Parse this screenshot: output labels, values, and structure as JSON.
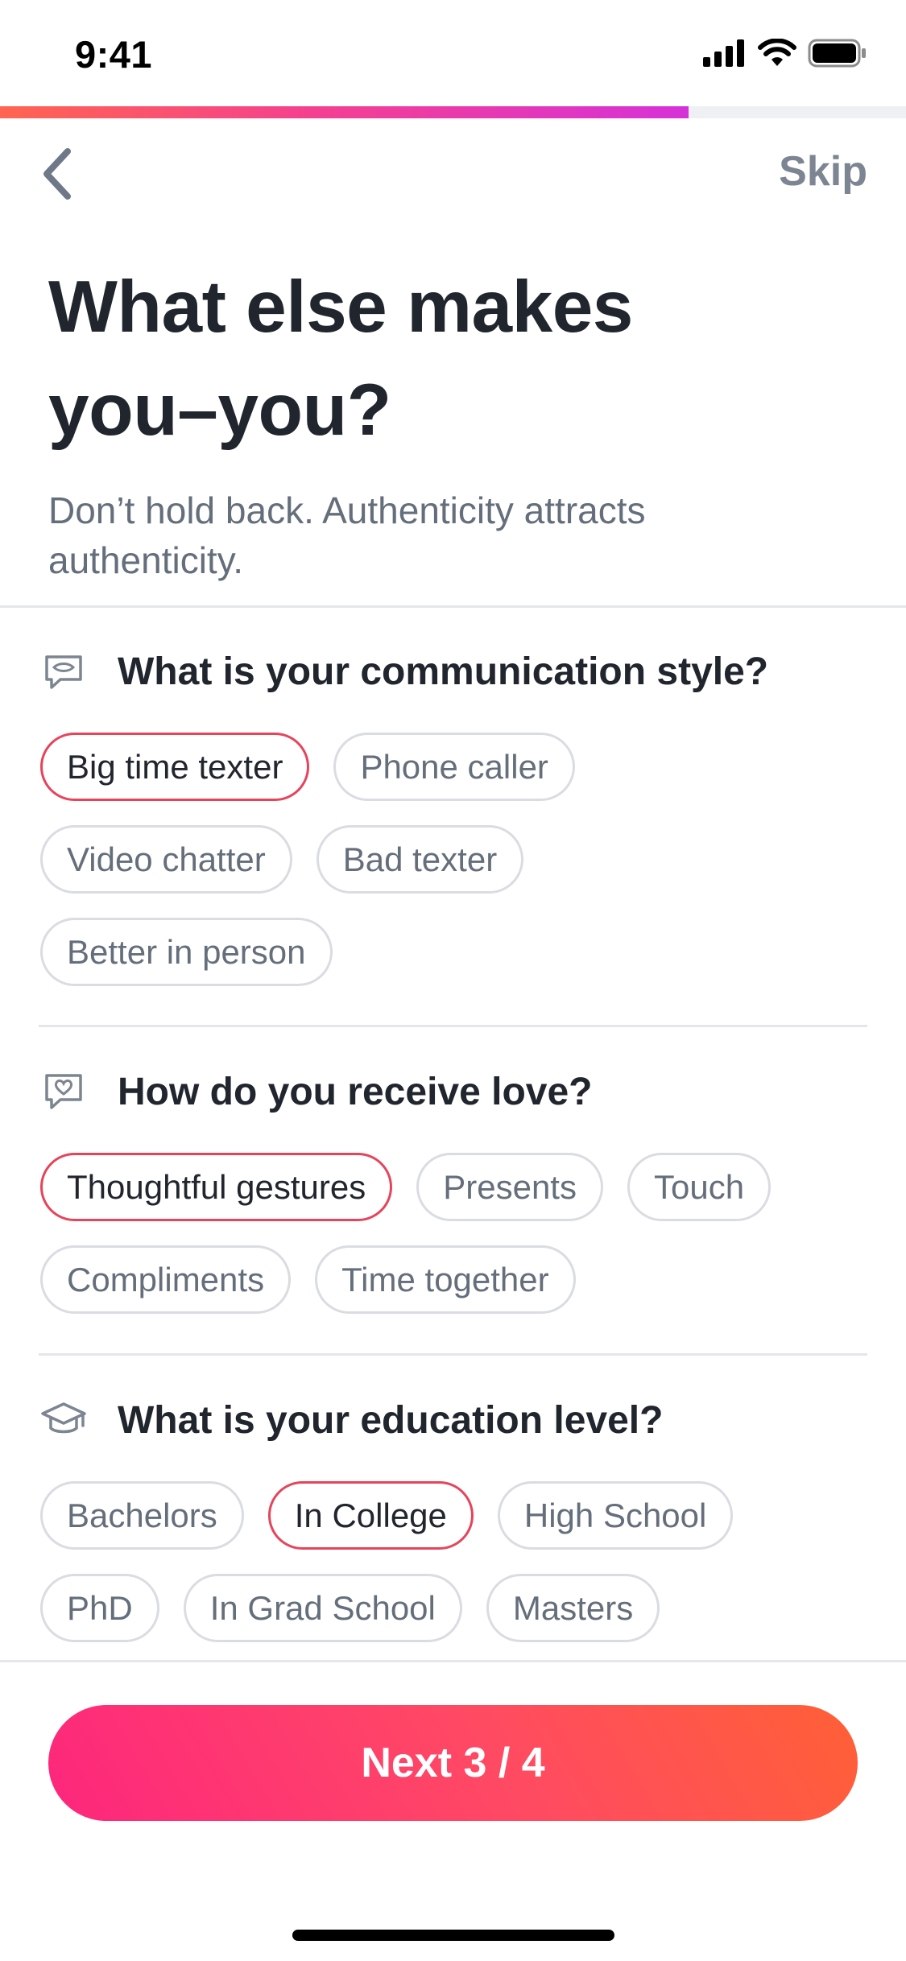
{
  "status_bar": {
    "time": "9:41"
  },
  "progress": {
    "fraction": 0.76
  },
  "nav": {
    "skip_label": "Skip"
  },
  "header": {
    "title_line1": "What else makes",
    "title_line2": "you–you?",
    "subtitle": "Don’t hold back. Authenticity attracts authenticity."
  },
  "sections": [
    {
      "icon": "chat-bubble-icon",
      "title": "What is your communication style?",
      "options": [
        {
          "label": "Big time texter",
          "selected": true
        },
        {
          "label": "Phone caller",
          "selected": false
        },
        {
          "label": "Video chatter",
          "selected": false
        },
        {
          "label": "Bad texter",
          "selected": false
        },
        {
          "label": "Better in person",
          "selected": false
        }
      ]
    },
    {
      "icon": "heart-message-icon",
      "title": "How do you receive love?",
      "options": [
        {
          "label": "Thoughtful gestures",
          "selected": true
        },
        {
          "label": "Presents",
          "selected": false
        },
        {
          "label": "Touch",
          "selected": false
        },
        {
          "label": "Compliments",
          "selected": false
        },
        {
          "label": "Time together",
          "selected": false
        }
      ]
    },
    {
      "icon": "graduation-cap-icon",
      "title": "What is your education level?",
      "options": [
        {
          "label": "Bachelors",
          "selected": false
        },
        {
          "label": "In College",
          "selected": true
        },
        {
          "label": "High School",
          "selected": false
        },
        {
          "label": "PhD",
          "selected": false
        },
        {
          "label": "In Grad School",
          "selected": false
        },
        {
          "label": "Masters",
          "selected": false
        }
      ]
    }
  ],
  "footer": {
    "next_label": "Next 3 / 4"
  },
  "colors": {
    "accent_selected_border": "#e6445b",
    "button_gradient_start": "#fd267d",
    "button_gradient_end": "#ff6036",
    "progress_gradient_start": "#ff6550",
    "progress_gradient_end": "#d631d9"
  }
}
